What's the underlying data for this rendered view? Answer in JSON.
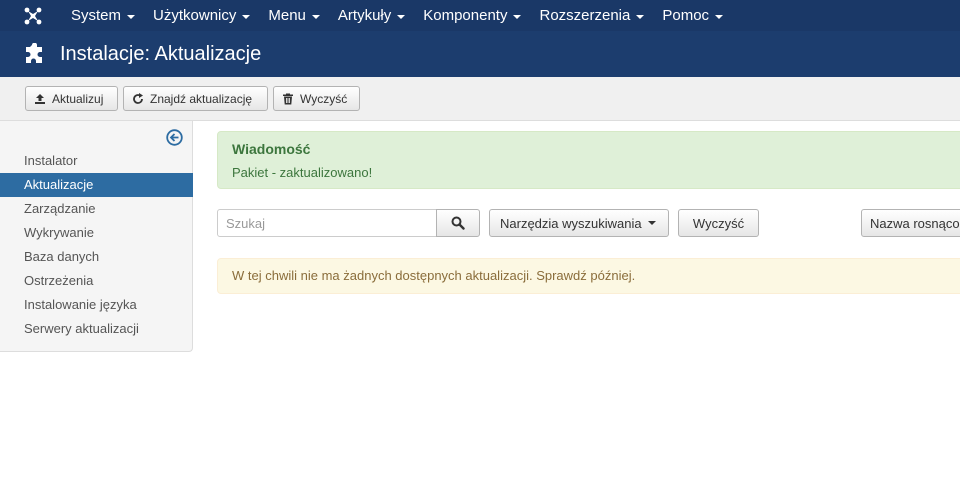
{
  "topnav": {
    "items": [
      {
        "label": "System"
      },
      {
        "label": "Użytkownicy"
      },
      {
        "label": "Menu"
      },
      {
        "label": "Artykuły"
      },
      {
        "label": "Komponenty"
      },
      {
        "label": "Rozszerzenia"
      },
      {
        "label": "Pomoc"
      }
    ]
  },
  "header": {
    "title": "Instalacje: Aktualizacje",
    "icon": "puzzle-icon"
  },
  "toolbar": {
    "update_label": "Aktualizuj",
    "find_label": "Znajdź aktualizację",
    "clear_label": "Wyczyść"
  },
  "sidebar": {
    "items": [
      {
        "label": "Instalator"
      },
      {
        "label": "Aktualizacje",
        "active": true
      },
      {
        "label": "Zarządzanie"
      },
      {
        "label": "Wykrywanie"
      },
      {
        "label": "Baza danych"
      },
      {
        "label": "Ostrzeżenia"
      },
      {
        "label": "Instalowanie języka"
      },
      {
        "label": "Serwery aktualizacji"
      }
    ]
  },
  "message": {
    "title": "Wiadomość",
    "text": "Pakiet - zaktualizowano!"
  },
  "search": {
    "placeholder": "Szukaj",
    "value": ""
  },
  "filters": {
    "tools_label": "Narzędzia wyszukiwania",
    "clear_label": "Wyczyść",
    "sort_label": "Nazwa rosnąco"
  },
  "notice": {
    "text": "W tej chwili nie ma żadnych dostępnych aktualizacji. Sprawdź później."
  },
  "colors": {
    "nav_bg": "#1a3867",
    "header_bg": "#1c3d6e",
    "active_item": "#2d6ca2",
    "success_bg": "#dff0d8",
    "warning_bg": "#fcf8e3"
  }
}
